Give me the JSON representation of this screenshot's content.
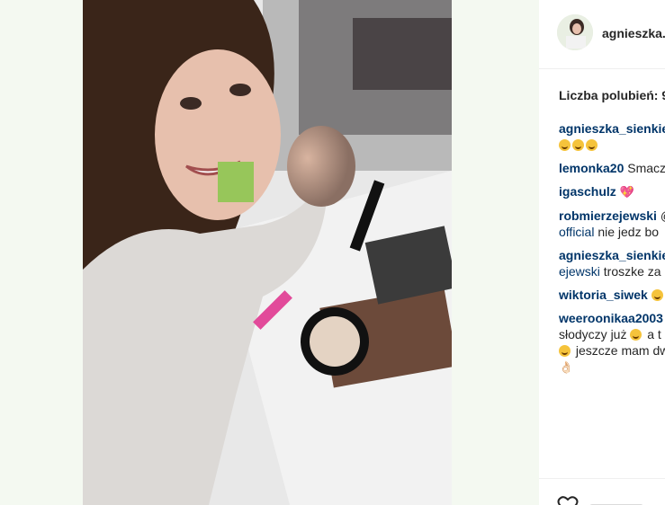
{
  "post": {
    "username": "agnieszka.",
    "likes_label": "Liczba polubień: 9"
  },
  "comments": [
    {
      "user": "agnieszka_sienkie",
      "lines": [],
      "emoji": [
        "grin-icon",
        "grin-icon",
        "grin-icon"
      ]
    },
    {
      "user": "lemonka20",
      "text": "Smacz"
    },
    {
      "user": "igaschulz",
      "text": "",
      "emoji": [
        "heart-icon"
      ]
    },
    {
      "user": "robmierzejewski",
      "suffix": "@",
      "line2_link": "official",
      "line2_text": " nie jedz bo"
    },
    {
      "user": "agnieszka_sienkie",
      "line2_link": "ejewski",
      "line2_text": " troszke za"
    },
    {
      "user": "wiktoria_siwek",
      "text": "",
      "emoji": [
        "grin-icon"
      ]
    },
    {
      "user": "weeroonikaa2003",
      "line2_text": "słodyczy już",
      "line2_tail": " a t",
      "line3_text": " jeszcze mam dw"
    }
  ]
}
